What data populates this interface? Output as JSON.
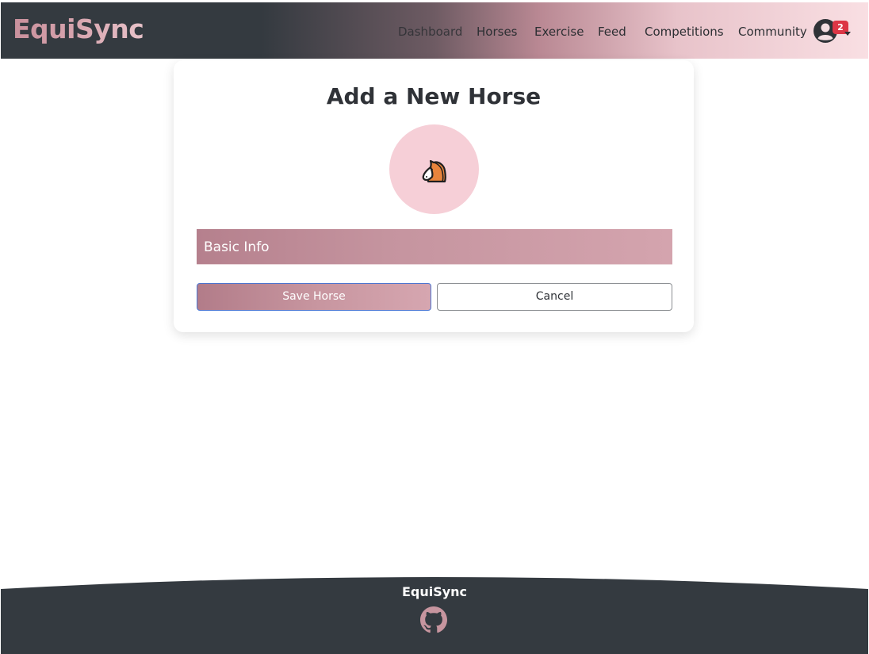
{
  "header": {
    "brand": "EquiSync",
    "nav": [
      {
        "label": "Dashboard"
      },
      {
        "label": "Horses"
      },
      {
        "label": "Exercise"
      },
      {
        "label": "Feed"
      },
      {
        "label": "Competitions"
      },
      {
        "label": "Community"
      }
    ],
    "user": {
      "icon": "user-circle-icon",
      "notification_count": "2"
    }
  },
  "form": {
    "title": "Add a New Horse",
    "avatar_icon": "horse-icon",
    "section_label": "Basic Info",
    "save_label": "Save Horse",
    "cancel_label": "Cancel"
  },
  "footer": {
    "brand": "EquiSync",
    "icon": "github-icon"
  },
  "colors": {
    "primary_pink": "#c7959f",
    "avatar_bg": "#f6cfd7",
    "dark": "#343a40",
    "badge": "#dc3545"
  }
}
